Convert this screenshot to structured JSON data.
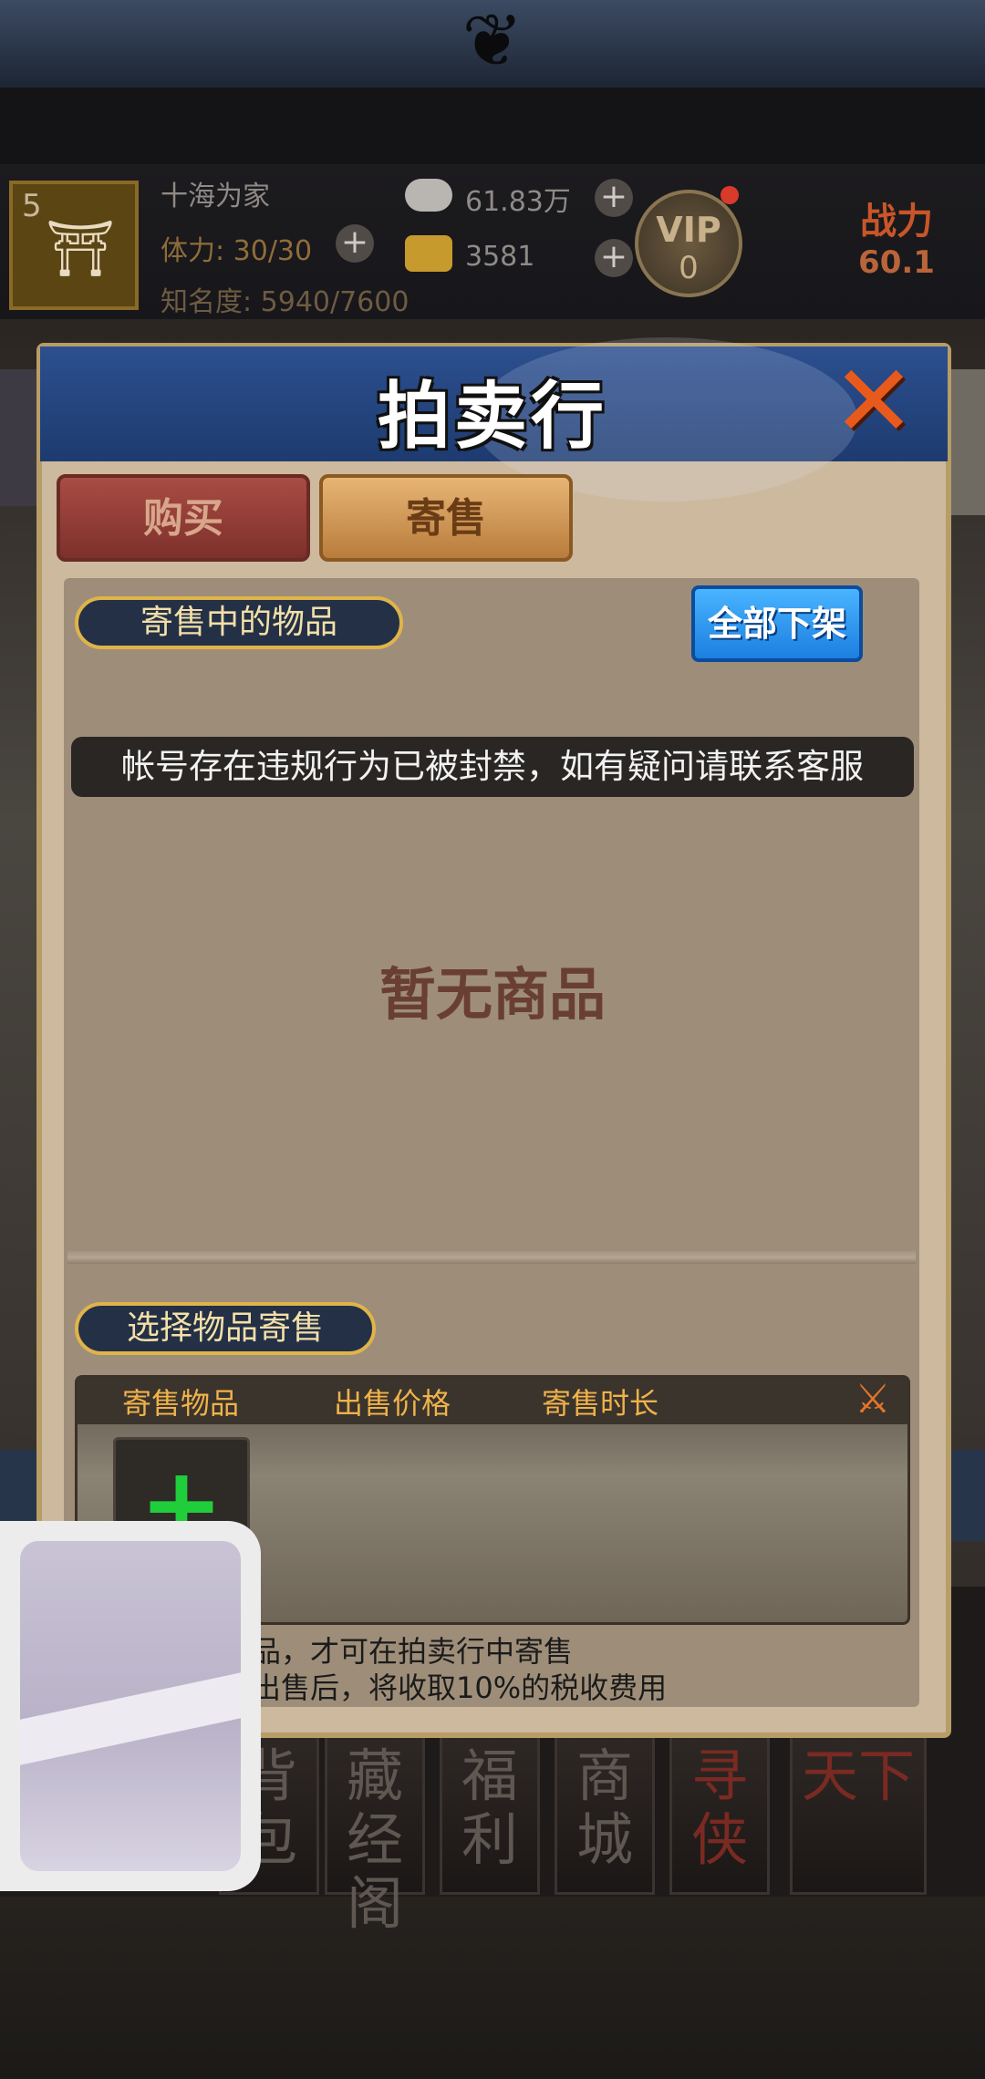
{
  "hud": {
    "level": "5",
    "player_name": "十海为家",
    "stamina": "体力: 30/30",
    "fame": "知名度: 5940/7600",
    "silver": "61.83万",
    "gold": "3581",
    "vip_label": "VIP",
    "vip_level": "0",
    "power_label": "战力",
    "power_value": "60.1"
  },
  "modal": {
    "title": "拍卖行",
    "tabs": [
      {
        "label": "购买",
        "active": false
      },
      {
        "label": "寄售",
        "active": true
      }
    ],
    "listing_section": "寄售中的物品",
    "unlist_all": "全部下架",
    "ban_notice": "帐号存在违规行为已被封禁，如有疑问请联系客服",
    "empty_text": "暂无商品",
    "select_section": "选择物品寄售",
    "columns": [
      "寄售物品",
      "出售价格",
      "寄售时长"
    ],
    "rules": [
      "品，才可在拍卖行中寄售",
      "出售后，将收取10%的税收费用"
    ]
  },
  "bottom_nav": [
    {
      "label": "背包"
    },
    {
      "label": "藏经阁"
    },
    {
      "label": "福利"
    },
    {
      "label": "商城"
    },
    {
      "label": "寻侠"
    },
    {
      "label": "天下"
    }
  ],
  "colors": {
    "modal_bg": "#cdb99e",
    "header_blue": "#234682",
    "accent_gold": "#e0b44a",
    "unlist_blue": "#2a8ff0",
    "add_green": "#1fce3a"
  },
  "icons": [
    "pagoda-icon",
    "silver-ingot-icon",
    "gold-ingot-icon",
    "plus-icon",
    "close-icon",
    "tools-icon",
    "add-icon"
  ]
}
